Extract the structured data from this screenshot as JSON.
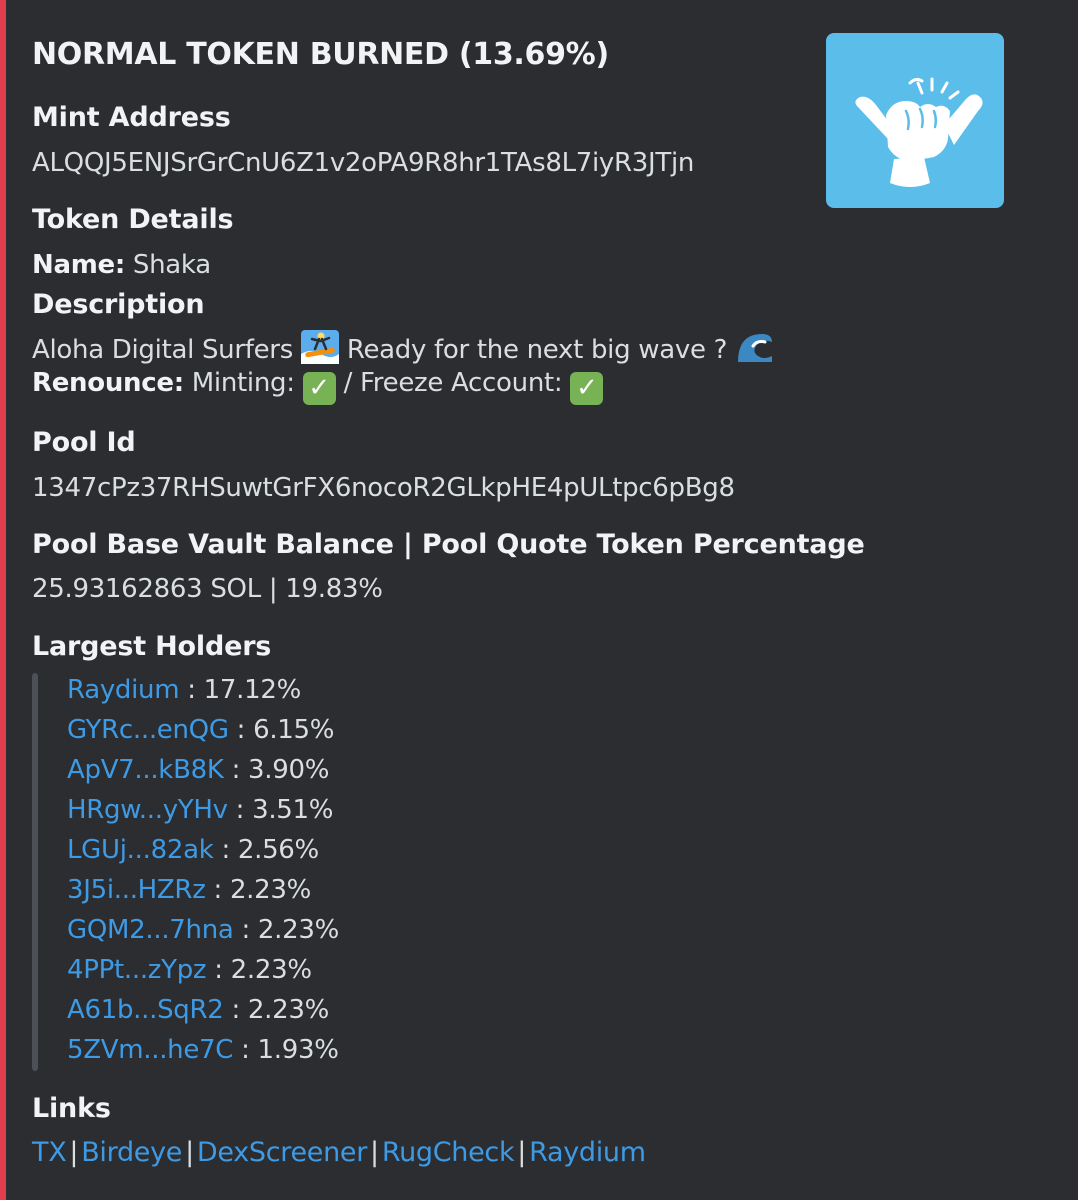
{
  "embed": {
    "title": "NORMAL TOKEN BURNED (13.69%)",
    "accent_color": "#e03e4e",
    "thumbnail": {
      "icon": "shaka-hand-icon",
      "background": "#5bbde9"
    }
  },
  "mint": {
    "label": "Mint Address",
    "value": "ALQQJ5ENJSrGrCnU6Z1v2oPA9R8hr1TAs8L7iyR3JTjn"
  },
  "token_details": {
    "label": "Token Details",
    "name_label": "Name:",
    "name_value": "Shaka",
    "description_label": "Description",
    "description_part1": "Aloha Digital Surfers",
    "description_part2": "Ready for the next big wave ?",
    "renounce_label": "Renounce:",
    "minting_label": "Minting:",
    "separator": "/",
    "freeze_label": "Freeze Account:"
  },
  "pool": {
    "id_label": "Pool Id",
    "id_value": "1347cPz37RHSuwtGrFX6nocoR2GLkpHE4pULtpc6pBg8",
    "balance_label": "Pool Base Vault Balance | Pool Quote Token Percentage",
    "balance_value": "25.93162863 SOL | 19.83%"
  },
  "holders": {
    "label": "Largest Holders",
    "items": [
      {
        "name": "Raydium",
        "value": ": 17.12%"
      },
      {
        "name": "GYRc...enQG",
        "value": ": 6.15%"
      },
      {
        "name": "ApV7...kB8K",
        "value": ": 3.90%"
      },
      {
        "name": "HRgw...yYHv",
        "value": ": 3.51%"
      },
      {
        "name": "LGUj...82ak",
        "value": ": 2.56%"
      },
      {
        "name": "3J5i...HZRz",
        "value": ": 2.23%"
      },
      {
        "name": "GQM2...7hna",
        "value": ": 2.23%"
      },
      {
        "name": "4PPt...zYpz",
        "value": ": 2.23%"
      },
      {
        "name": "A61b...SqR2",
        "value": ": 2.23%"
      },
      {
        "name": "5ZVm...he7C",
        "value": ": 1.93%"
      }
    ]
  },
  "links": {
    "label": "Links",
    "items": [
      "TX",
      "Birdeye",
      "DexScreener",
      "RugCheck",
      "Raydium"
    ],
    "separator": "|"
  },
  "colors": {
    "background": "#2b2d31",
    "link": "#3f9ae4",
    "check": "#77b255"
  }
}
